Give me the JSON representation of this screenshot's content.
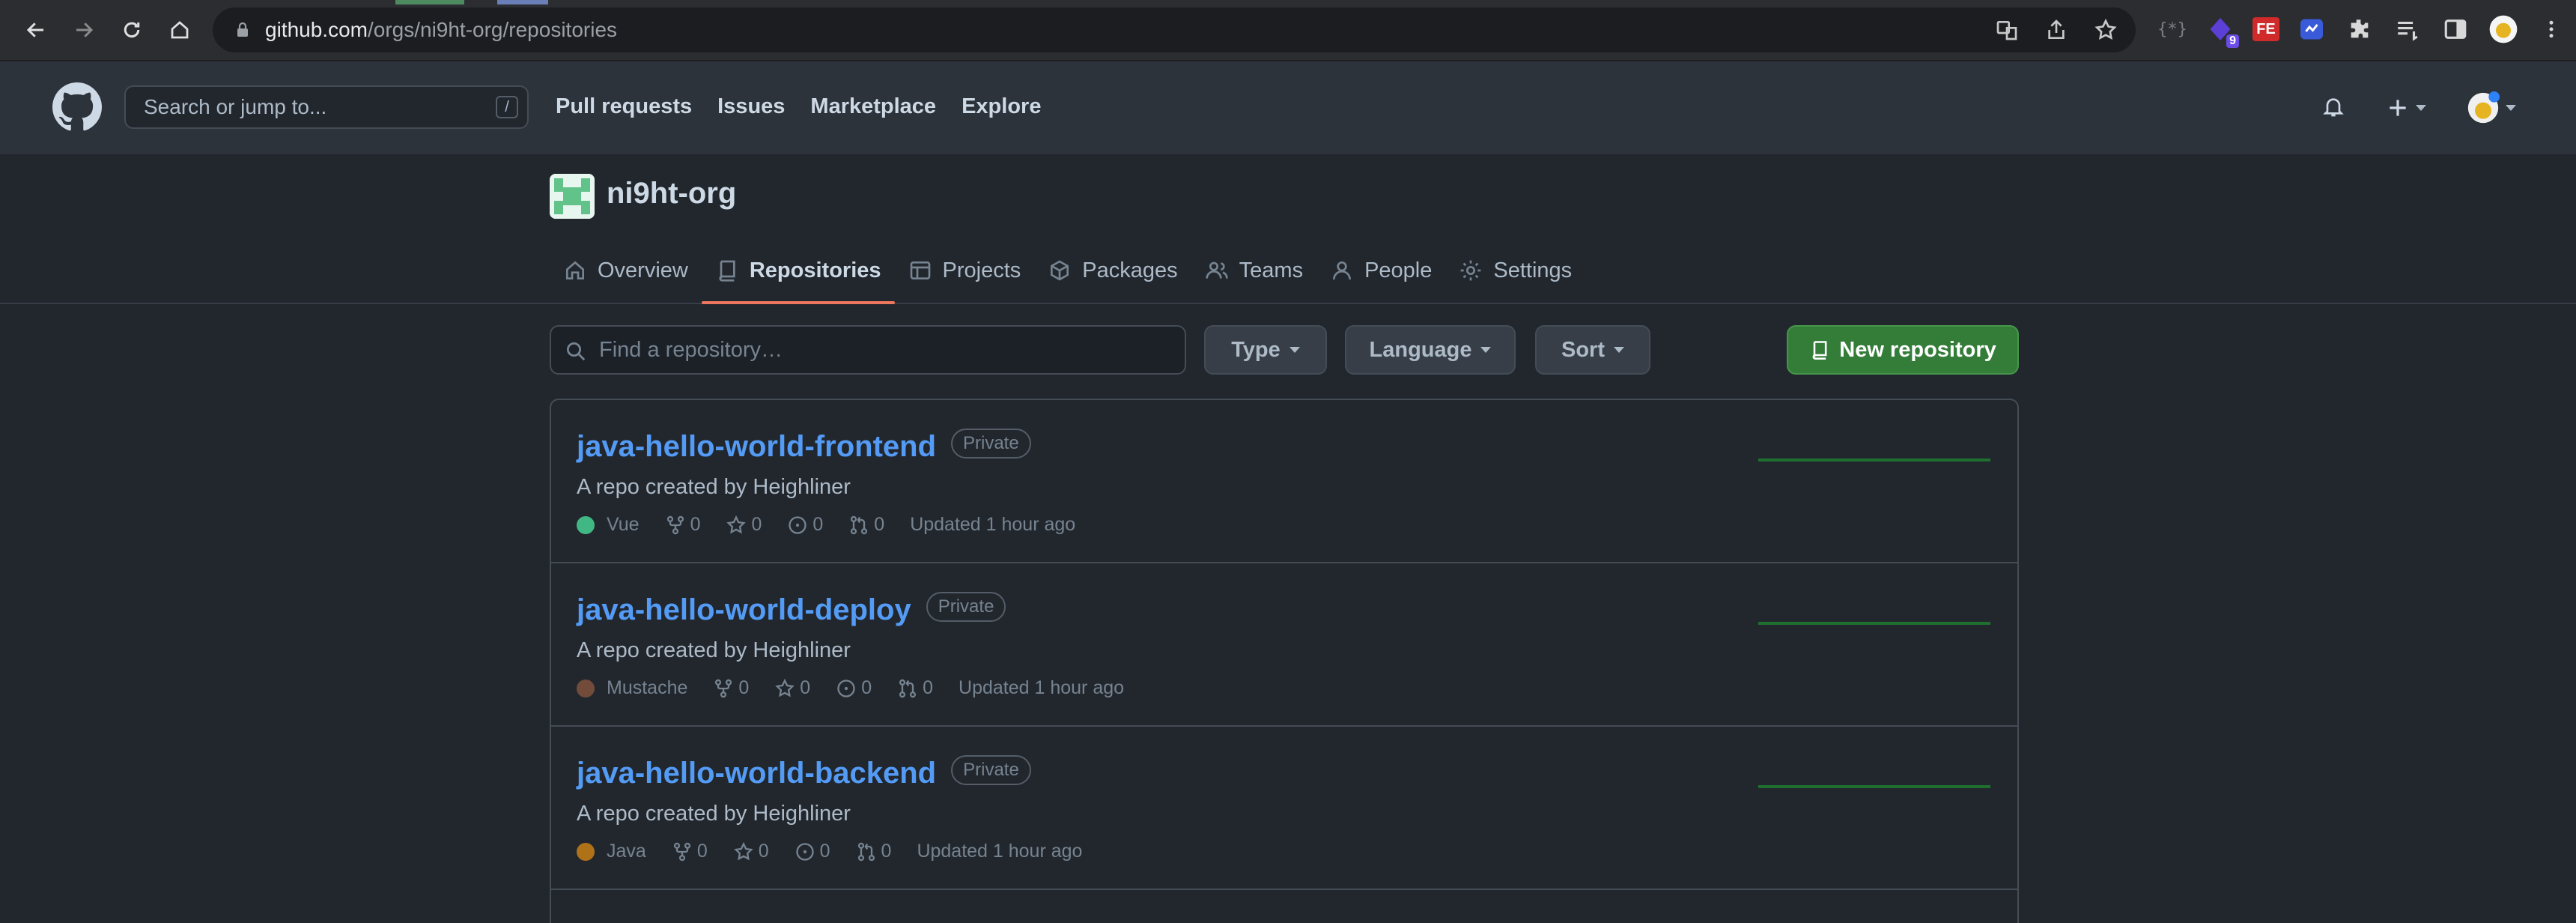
{
  "browser": {
    "url_host": "github.com",
    "url_path": "/orgs/ni9ht-org/repositories",
    "extension_badge": "9",
    "extension_fe_label": "FE"
  },
  "header": {
    "search_placeholder": "Search or jump to...",
    "search_shortcut": "/",
    "nav": [
      "Pull requests",
      "Issues",
      "Marketplace",
      "Explore"
    ]
  },
  "org": {
    "name": "ni9ht-org",
    "tabs": [
      {
        "label": "Overview",
        "icon": "home-icon"
      },
      {
        "label": "Repositories",
        "icon": "repo-icon",
        "selected": true
      },
      {
        "label": "Projects",
        "icon": "table-icon"
      },
      {
        "label": "Packages",
        "icon": "package-icon"
      },
      {
        "label": "Teams",
        "icon": "people-icon"
      },
      {
        "label": "People",
        "icon": "person-icon"
      },
      {
        "label": "Settings",
        "icon": "gear-icon"
      }
    ]
  },
  "filters": {
    "find_placeholder": "Find a repository…",
    "type_label": "Type",
    "language_label": "Language",
    "sort_label": "Sort",
    "new_repo_label": "New repository"
  },
  "repos": [
    {
      "name": "java-hello-world-frontend",
      "visibility": "Private",
      "description": "A repo created by Heighliner",
      "language": "Vue",
      "language_color": "#41b883",
      "forks": "0",
      "stars": "0",
      "issues": "0",
      "prs": "0",
      "updated": "Updated 1 hour ago"
    },
    {
      "name": "java-hello-world-deploy",
      "visibility": "Private",
      "description": "A repo created by Heighliner",
      "language": "Mustache",
      "language_color": "#724b3b",
      "forks": "0",
      "stars": "0",
      "issues": "0",
      "prs": "0",
      "updated": "Updated 1 hour ago"
    },
    {
      "name": "java-hello-world-backend",
      "visibility": "Private",
      "description": "A repo created by Heighliner",
      "language": "Java",
      "language_color": "#b07219",
      "forks": "0",
      "stars": "0",
      "issues": "0",
      "prs": "0",
      "updated": "Updated 1 hour ago"
    }
  ],
  "colors": {
    "accent_tab_underline": "#ec775c",
    "link": "#539bf5",
    "new_repo_bg": "#347d39"
  }
}
